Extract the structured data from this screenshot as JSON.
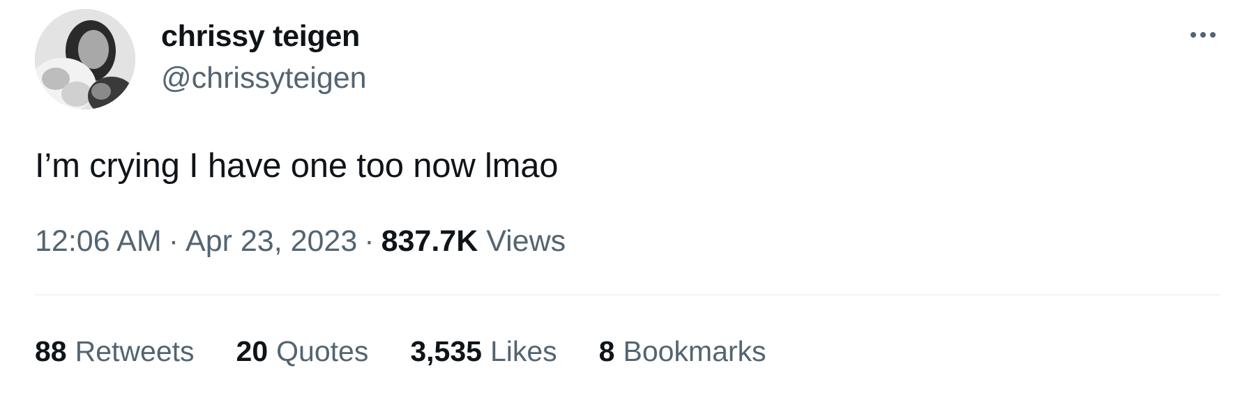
{
  "author": {
    "display_name": "chrissy teigen",
    "handle": "@chrissyteigen"
  },
  "tweet": {
    "text": "I’m crying I have one too now lmao",
    "time": "12:06 AM",
    "date": "Apr 23, 2023",
    "separator": "·",
    "views_count": "837.7K",
    "views_label": "Views"
  },
  "stats": [
    {
      "count": "88",
      "label": "Retweets"
    },
    {
      "count": "20",
      "label": "Quotes"
    },
    {
      "count": "3,535",
      "label": "Likes"
    },
    {
      "count": "8",
      "label": "Bookmarks"
    }
  ],
  "icons": {
    "more": "more-horizontal-icon"
  },
  "colors": {
    "text_primary": "#0f1419",
    "text_secondary": "#536471",
    "divider": "#eff3f4",
    "background": "#ffffff"
  }
}
